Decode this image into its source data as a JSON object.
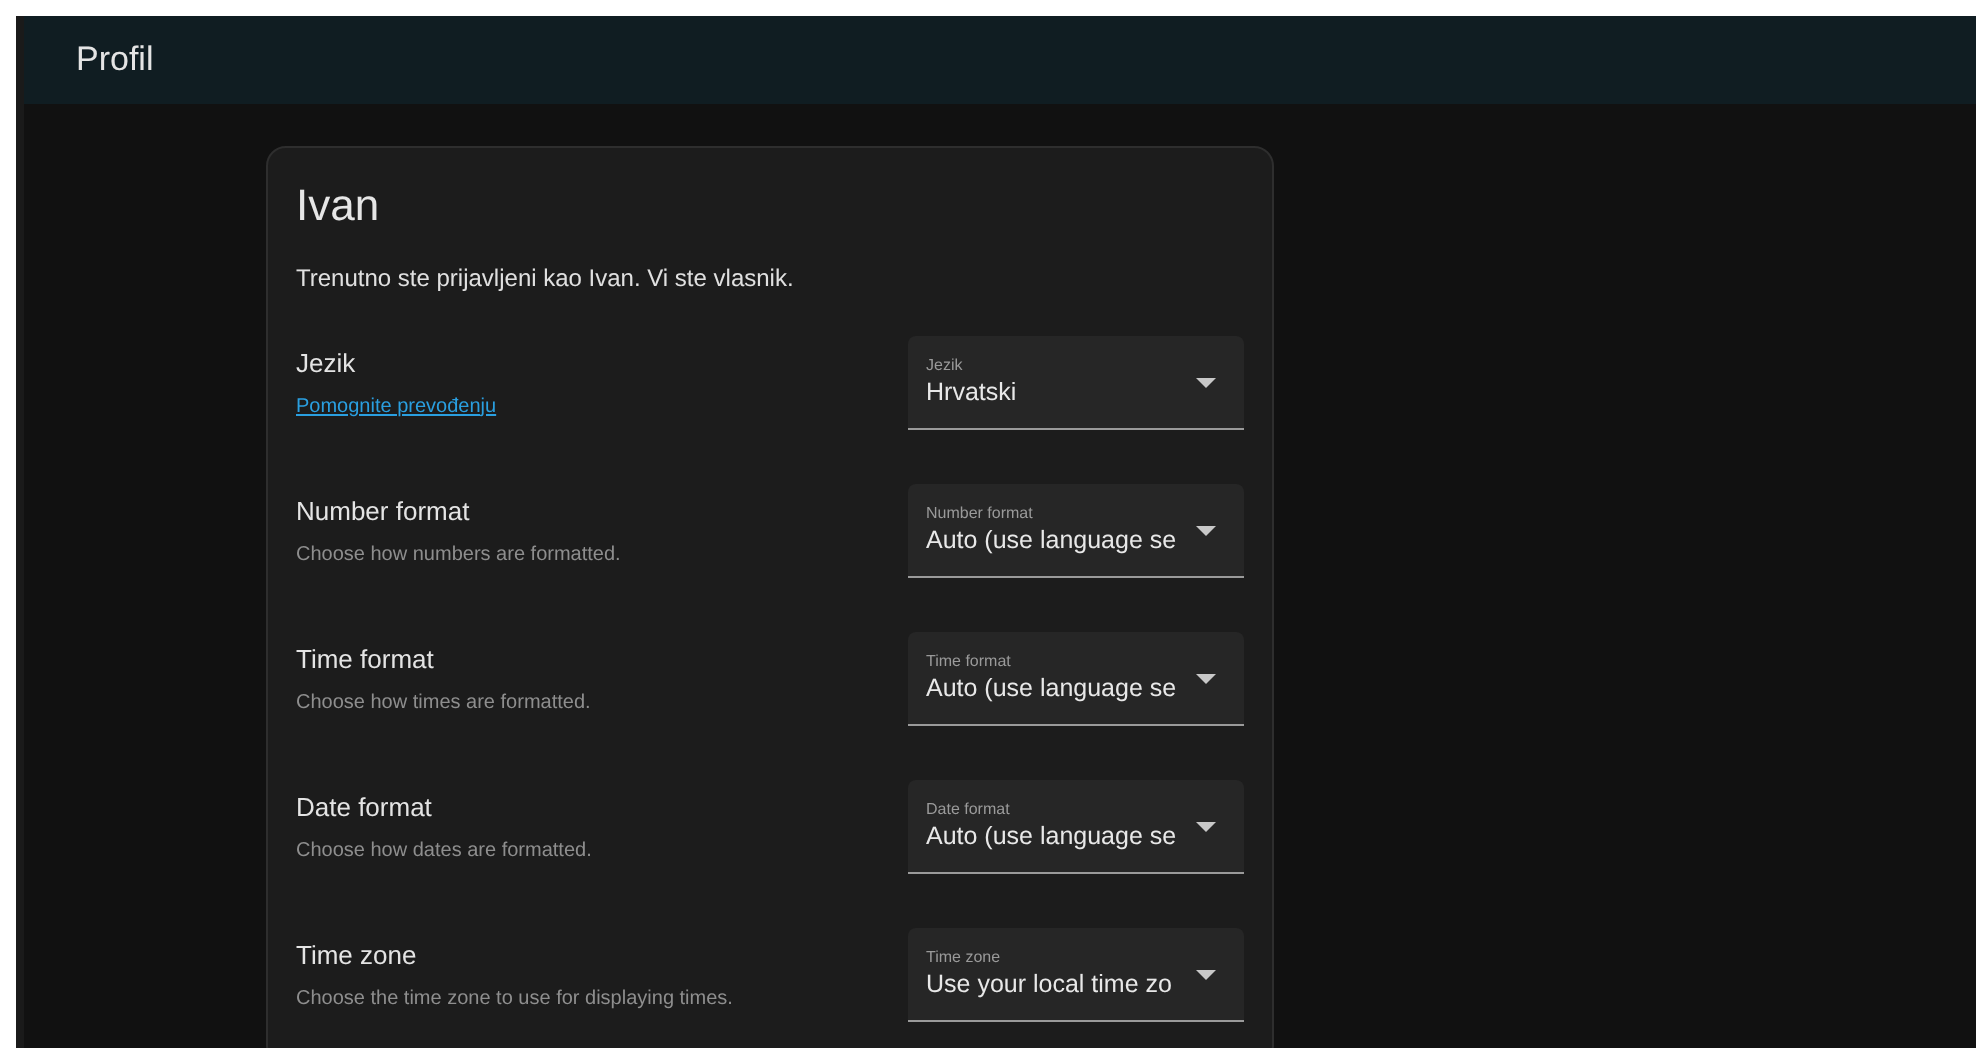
{
  "header": {
    "title": "Profil"
  },
  "card": {
    "title": "Ivan",
    "intro": "Trenutno ste prijavljeni kao Ivan. Vi ste vlasnik."
  },
  "settings": [
    {
      "label": "Jezik",
      "description": {
        "kind": "link",
        "text": "Pomognite prevođenju"
      },
      "select": {
        "label": "Jezik",
        "value": "Hrvatski"
      }
    },
    {
      "label": "Number format",
      "description": {
        "kind": "text",
        "text": "Choose how numbers are formatted."
      },
      "select": {
        "label": "Number format",
        "value": "Auto (use language se"
      }
    },
    {
      "label": "Time format",
      "description": {
        "kind": "text",
        "text": "Choose how times are formatted."
      },
      "select": {
        "label": "Time format",
        "value": "Auto (use language se"
      }
    },
    {
      "label": "Date format",
      "description": {
        "kind": "text",
        "text": "Choose how dates are formatted."
      },
      "select": {
        "label": "Date format",
        "value": "Auto (use language se"
      }
    },
    {
      "label": "Time zone",
      "description": {
        "kind": "text",
        "text": "Choose the time zone to use for displaying times."
      },
      "select": {
        "label": "Time zone",
        "value": "Use your local time zo"
      }
    }
  ]
}
